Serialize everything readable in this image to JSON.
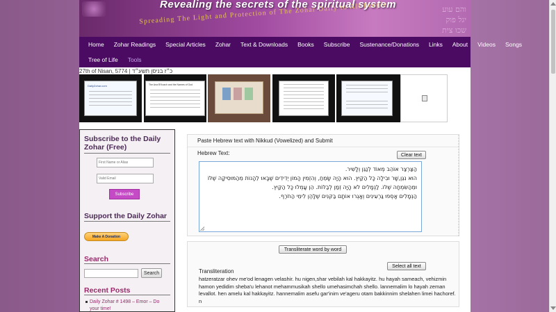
{
  "banner": {
    "title": "Revealing the secrets of the spiritual system",
    "subtitle": "Spreading The Light and Protection of The Zohar Daily to All People",
    "hebrew_letters": [
      "והם עוע",
      "יגל פוק",
      "שכו צית"
    ]
  },
  "nav": {
    "row1": [
      "Home",
      "Zohar Readings",
      "Special Articles",
      "Zohar",
      "Text & Downloads",
      "Books",
      "Subscribe",
      "Sustenance/Donations",
      "Links",
      "About",
      "Videos",
      "Songs"
    ],
    "row2": [
      "Tree of Life",
      "Tools"
    ],
    "active": "Tools"
  },
  "date": "27th of Nisan, 5774 | כ״ז בניסן תשע״ד",
  "thumbnails": [
    {
      "caption": "DailyZohar.com"
    },
    {
      "caption": "The Ana B'Koach and the Names of God"
    },
    {
      "caption": ""
    },
    {
      "caption": ""
    },
    {
      "caption": ""
    },
    {
      "caption": ""
    }
  ],
  "sidebar": {
    "subscribe_heading": "Subscribe to the Daily Zohar (Free)",
    "first_name_placeholder": "First Name or Alias",
    "email_placeholder": "Valid Email",
    "subscribe_button": "Subscribe",
    "support_heading": "Support the Daily Zohar",
    "donate_button": "Make A Donation",
    "search_heading": "Search",
    "search_button": "Search",
    "recent_heading": "Recent Posts",
    "recent_posts": [
      "Daily Zohar # 1498 – Emor – Do your time!"
    ]
  },
  "tool": {
    "title": "Paste Hebrew text with Nikkud (Vowelized) and Submit",
    "hebrew_label": "Hebrew Text:",
    "clear_button": "Clear text",
    "hebrew_text": [
      "הַצַּרְצַר אוֹהֵב מְאוֹד לְנַגֵּן וְלָשִׁיר.",
      "הוּא נִגֵּן,שָׁר וּבִילָה כָּל הַקַּיִץ. הוּא הָיָה שָׂמֵחַ, וְהִזְמִין הָמוֹן יְדִידִים שֶׁבָּאוּ לֵהָנוֹת מֵהַמּוּסִיקָה שֶׁלּוֹ",
      "וּמֵהַשִּׂמְחָה שֶׁלּוֹ. לַנְּמָלִים לֹא הָיָה זְמַן לְבַלּוֹת. הֵן עָמְלוּ כָּל הַקַּיִץ.",
      "הַנְּמָלִים אָסְפוּ גַּרְעִינִים וְאָגְרוּ אוֹתָם בַּקִּנִּים שֶׁלָּהֶן לִימֵי הַחֹרֶף."
    ],
    "transliterate_button": "Transliterate word by word",
    "select_all_button": "Select all text",
    "transliteration_label": "Transliteration",
    "transliteration_text": "hatzeratzar ohev me'od lenagen velashir. hu nigen,shar vebilah kal hakkayitz. hu hayah sameach, vehizmin hamon yedidim sheba'u lehanot mehammusikah shello umehasimchah shello. lannemalim lo hayah zeman levallot. hen amelu kal hakkayitz. hannemalim asefu gar'inim ve'ageru otam bakkinnim shelahen limei hachoref. n"
  }
}
